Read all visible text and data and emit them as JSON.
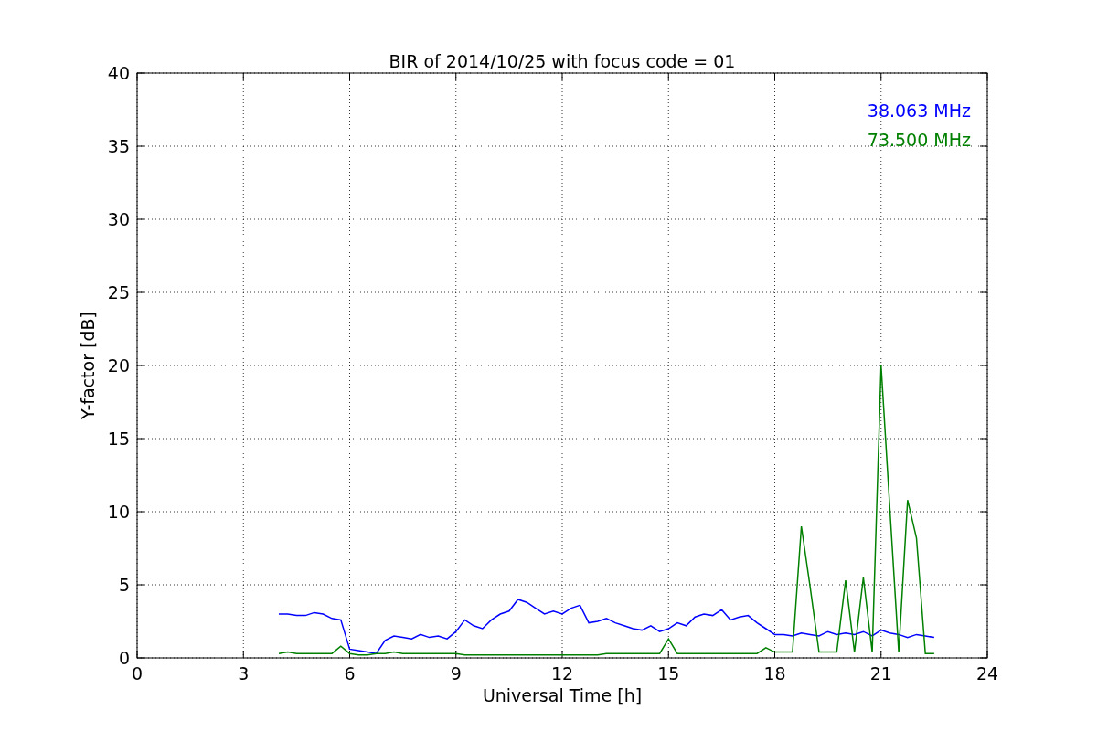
{
  "chart_data": {
    "type": "line",
    "title": "BIR of 2014/10/25 with focus code = 01",
    "xlabel": "Universal Time [h]",
    "ylabel": "Y-factor [dB]",
    "x": [
      4,
      4.25,
      4.5,
      4.75,
      5,
      5.25,
      5.5,
      5.75,
      6,
      6.25,
      6.5,
      6.75,
      7,
      7.25,
      7.5,
      7.75,
      8,
      8.25,
      8.5,
      8.75,
      9,
      9.25,
      9.5,
      9.75,
      10,
      10.25,
      10.5,
      10.75,
      11,
      11.25,
      11.5,
      11.75,
      12,
      12.25,
      12.5,
      12.75,
      13,
      13.25,
      13.5,
      13.75,
      14,
      14.25,
      14.5,
      14.75,
      15,
      15.25,
      15.5,
      15.75,
      16,
      16.25,
      16.5,
      16.75,
      17,
      17.25,
      17.5,
      17.75,
      18,
      18.25,
      18.5,
      18.75,
      19,
      19.25,
      19.5,
      19.75,
      20,
      20.25,
      20.5,
      20.75,
      21,
      21.25,
      21.5,
      21.75,
      22,
      22.25,
      22.5
    ],
    "series": [
      {
        "name": "38.063 MHz",
        "color": "#0000ff",
        "values": [
          3.0,
          3.0,
          2.9,
          2.9,
          3.1,
          3.0,
          2.7,
          2.6,
          0.6,
          0.5,
          0.4,
          0.3,
          1.2,
          1.5,
          1.4,
          1.3,
          1.6,
          1.4,
          1.5,
          1.3,
          1.8,
          2.6,
          2.2,
          2.0,
          2.6,
          3.0,
          3.2,
          4.0,
          3.8,
          3.4,
          3.0,
          3.2,
          3.0,
          3.4,
          3.6,
          2.4,
          2.5,
          2.7,
          2.4,
          2.2,
          2.0,
          1.9,
          2.2,
          1.8,
          2.0,
          2.4,
          2.2,
          2.8,
          3.0,
          2.9,
          3.3,
          2.6,
          2.8,
          2.9,
          2.4,
          2.0,
          1.6,
          1.6,
          1.5,
          1.7,
          1.6,
          1.5,
          1.8,
          1.6,
          1.7,
          1.6,
          1.8,
          1.5,
          1.9,
          1.7,
          1.6,
          1.4,
          1.6,
          1.5,
          1.4
        ]
      },
      {
        "name": "73.500 MHz",
        "color": "#008000",
        "values": [
          0.3,
          0.4,
          0.3,
          0.3,
          0.3,
          0.3,
          0.3,
          0.8,
          0.3,
          0.2,
          0.2,
          0.3,
          0.3,
          0.4,
          0.3,
          0.3,
          0.3,
          0.3,
          0.3,
          0.3,
          0.3,
          0.2,
          0.2,
          0.2,
          0.2,
          0.2,
          0.2,
          0.2,
          0.2,
          0.2,
          0.2,
          0.2,
          0.2,
          0.2,
          0.2,
          0.2,
          0.2,
          0.3,
          0.3,
          0.3,
          0.3,
          0.3,
          0.3,
          0.3,
          1.3,
          0.3,
          0.3,
          0.3,
          0.3,
          0.3,
          0.3,
          0.3,
          0.3,
          0.3,
          0.3,
          0.7,
          0.4,
          0.4,
          0.4,
          9.0,
          4.8,
          0.4,
          0.4,
          0.4,
          5.3,
          0.4,
          5.5,
          0.4,
          20.0,
          10.2,
          0.4,
          10.8,
          8.2,
          0.3,
          0.3
        ]
      }
    ],
    "grid": true,
    "xlim": [
      0,
      24
    ],
    "ylim": [
      0,
      40
    ],
    "xticks": [
      0,
      3,
      6,
      9,
      12,
      15,
      18,
      21,
      24
    ],
    "yticks": [
      0,
      5,
      10,
      15,
      20,
      25,
      30,
      35,
      40
    ]
  }
}
